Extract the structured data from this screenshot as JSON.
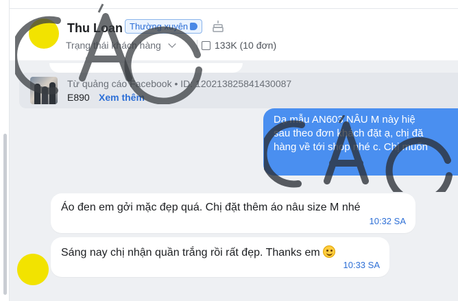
{
  "contact": {
    "name": "Thu Loan",
    "badge": "Thường xuyên",
    "status_dropdown": "Trạng thái khách hàng",
    "spend": "133K (10 đơn)"
  },
  "ad": {
    "source": "Từ quảng cáo Facebook • ID: 120213825841430087",
    "code": "E890",
    "more_link": "Xem thêm"
  },
  "messages": {
    "outgoing_lines": [
      "Dạ mẫu   AN603 NÂU M  này hiệ",
      "sau theo đơn khách đặt ạ, chị đặ",
      "hàng về tới shop nhé c. Chị muốn"
    ],
    "incoming": [
      {
        "text": "Áo đen em gởi mặc đẹp quá. Chị đặt thêm áo nâu size M nhé",
        "time": "10:32 SA"
      },
      {
        "text": "Sáng nay chị nhận quần trắng rồi rất đẹp. Thanks em",
        "time": "10:33 SA"
      }
    ]
  },
  "icons": {
    "tag": "tag-icon",
    "cake": "birthday-cake-icon",
    "box": "box-icon",
    "chevron": "chevron-down-icon",
    "emoji": "smiling-face-emoji"
  },
  "colors": {
    "accent": "#2d6fd6",
    "outgoing_bubble": "#4a8ff0",
    "avatar": "#f2e300",
    "badge_bg": "#eaf3ff"
  }
}
